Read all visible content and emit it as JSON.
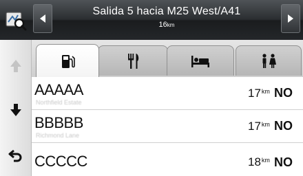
{
  "header": {
    "title": "Salida 5 hacia M25 West/A41",
    "distance": "16",
    "distance_unit": "km"
  },
  "tabs": [
    {
      "icon": "fuel-icon",
      "active": true
    },
    {
      "icon": "restaurant-icon",
      "active": false
    },
    {
      "icon": "lodging-icon",
      "active": false
    },
    {
      "icon": "restroom-icon",
      "active": false
    }
  ],
  "results": [
    {
      "name": "AAAAA",
      "address": "Northfield Estate",
      "distance": "17",
      "unit": "km",
      "direction": "NO"
    },
    {
      "name": "BBBBB",
      "address": "Richmond Lane",
      "distance": "17",
      "unit": "km",
      "direction": "NO"
    },
    {
      "name": "CCCCC",
      "address": "",
      "distance": "18",
      "unit": "km",
      "direction": "NO"
    }
  ],
  "colors": {
    "header_dark": "#1a1c1e",
    "header_text": "#ffffff",
    "tab_active": "#ffffff",
    "tab_inactive": "#b6b6b6"
  }
}
